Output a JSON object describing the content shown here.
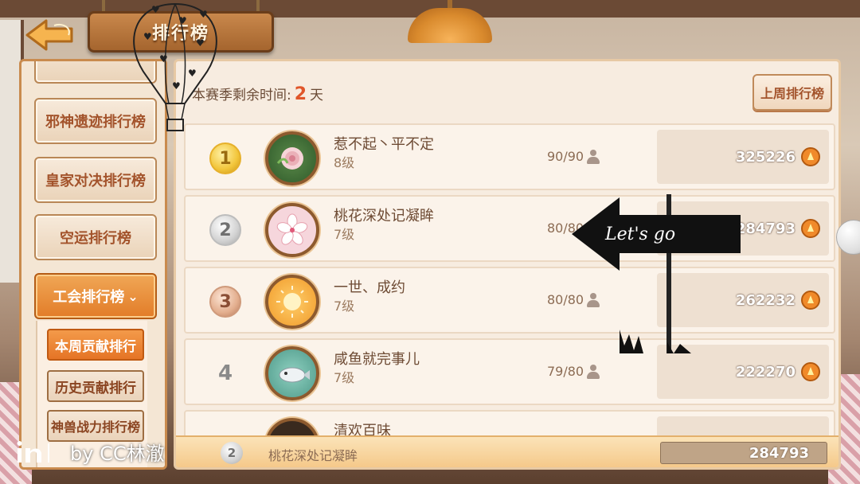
{
  "title": "排行榜",
  "season": {
    "label": "本赛季剩余时间:",
    "days": "2",
    "unit": "天"
  },
  "last_week_button": "上周排行榜",
  "sidebar": {
    "items": [
      {
        "label": "",
        "state": "partial"
      },
      {
        "label": "邪神遗迹排行榜"
      },
      {
        "label": "皇家对决排行榜"
      },
      {
        "label": "空运排行榜"
      },
      {
        "label": "工会排行榜",
        "state": "active"
      }
    ],
    "submenu": [
      {
        "label": "本周贡献排行",
        "state": "active"
      },
      {
        "label": "历史贡献排行"
      },
      {
        "label": "神兽战力排行榜"
      }
    ]
  },
  "rankings": [
    {
      "rank": "1",
      "medal": "gold",
      "name": "惹不起丶平不定",
      "level": "8级",
      "members": "90/90",
      "score": "325226",
      "avatar_icon": "rose-icon"
    },
    {
      "rank": "2",
      "medal": "silver",
      "name": "桃花深处记凝眸",
      "level": "7级",
      "members": "80/80",
      "score": "284793",
      "avatar_icon": "sakura-icon"
    },
    {
      "rank": "3",
      "medal": "bronze",
      "name": "一世、成约",
      "level": "7级",
      "members": "80/80",
      "score": "262232",
      "avatar_icon": "sun-icon"
    },
    {
      "rank": "4",
      "medal": "plain",
      "name": "咸鱼就完事儿",
      "level": "7级",
      "members": "79/80",
      "score": "222270",
      "avatar_icon": "fish-icon"
    },
    {
      "rank": "",
      "medal": "plain",
      "name": "清欢百味",
      "level": "",
      "members": "",
      "score": "",
      "avatar_icon": "dark-avatar-icon"
    }
  ],
  "my_guild": {
    "rank": "2",
    "name": "桃花深处记凝眸",
    "score": "284793"
  },
  "overlay": {
    "sign_text": "Let's go",
    "watermark": "by CC林澈"
  },
  "colors": {
    "accent_orange": "#e27c28",
    "days_red": "#e0562a",
    "panel_bg": "#f7ece0"
  }
}
